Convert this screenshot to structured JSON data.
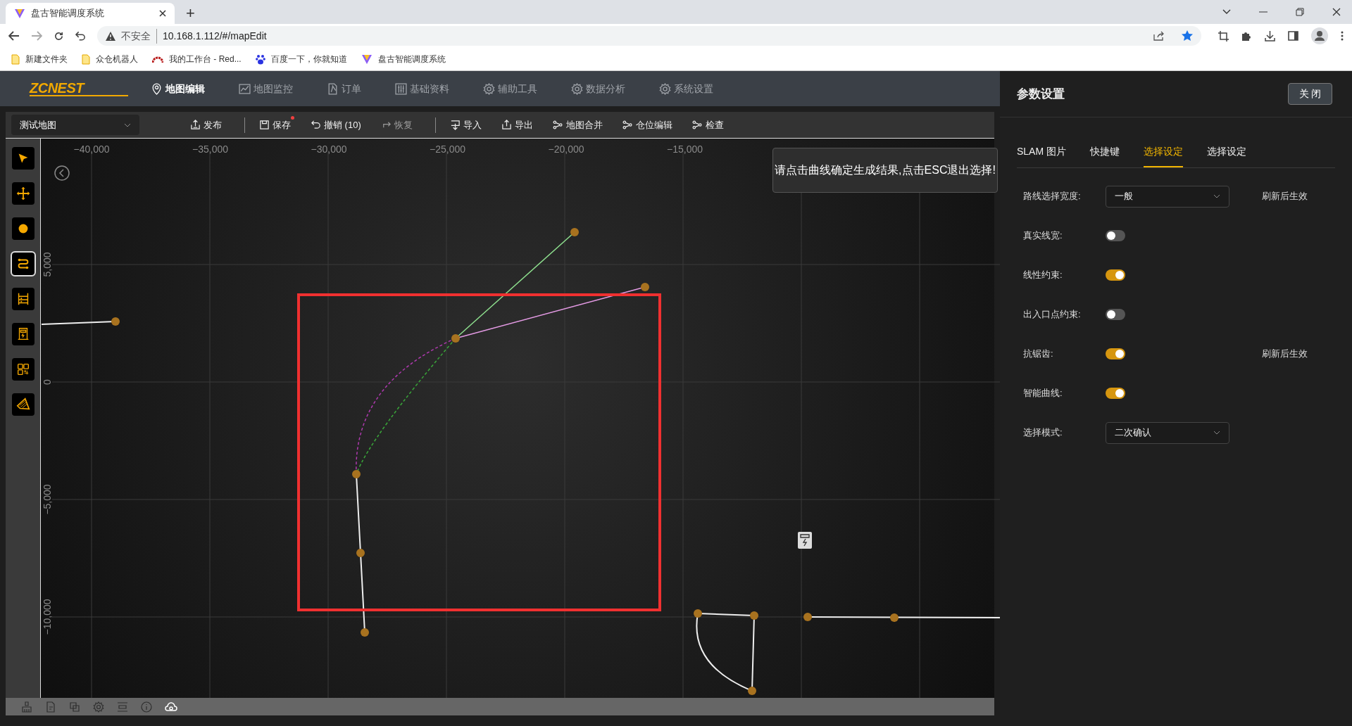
{
  "browser": {
    "tab_title": "盘古智能调度系统",
    "new_tab": "+",
    "security_label": "不安全",
    "url": "10.168.1.112/#/mapEdit",
    "bookmarks": [
      {
        "label": "新建文件夹",
        "kind": "folder"
      },
      {
        "label": "众仓机器人",
        "kind": "folder"
      },
      {
        "label": "我的工作台 - Red...",
        "kind": "redmine"
      },
      {
        "label": "百度一下，你就知道",
        "kind": "baidu"
      },
      {
        "label": "盘古智能调度系统",
        "kind": "app"
      }
    ]
  },
  "app": {
    "logo": "ZCNEST",
    "nav": [
      {
        "label": "地图编辑",
        "selected": true
      },
      {
        "label": "地图监控",
        "selected": false
      },
      {
        "label": "订单",
        "selected": false
      },
      {
        "label": "基础资料",
        "selected": false
      },
      {
        "label": "辅助工具",
        "selected": false
      },
      {
        "label": "数据分析",
        "selected": false
      },
      {
        "label": "系统设置",
        "selected": false
      }
    ]
  },
  "toolbar": {
    "map_select": "测试地图",
    "groups": [
      [
        {
          "label": "发布",
          "disabled": false,
          "unsaved": false
        }
      ],
      [
        {
          "label": "保存",
          "disabled": false,
          "unsaved": true
        },
        {
          "label": "撤销 (10)",
          "disabled": false,
          "unsaved": false
        },
        {
          "label": "恢复",
          "disabled": true,
          "unsaved": false
        }
      ],
      [
        {
          "label": "导入",
          "disabled": false,
          "unsaved": false
        },
        {
          "label": "导出",
          "disabled": false,
          "unsaved": false
        },
        {
          "label": "地图合并",
          "disabled": false,
          "unsaved": false
        },
        {
          "label": "仓位编辑",
          "disabled": false,
          "unsaved": false
        },
        {
          "label": "检查",
          "disabled": false,
          "unsaved": false
        }
      ]
    ]
  },
  "tools": [
    {
      "selected": false
    },
    {
      "selected": false
    },
    {
      "selected": false
    },
    {
      "selected": true
    },
    {
      "selected": false
    },
    {
      "selected": false
    },
    {
      "selected": false
    },
    {
      "selected": false
    }
  ],
  "map": {
    "x_labels": [
      "−40,000",
      "−35,000",
      "−30,000",
      "−25,000",
      "−20,000",
      "−15,000"
    ],
    "y_labels": [
      "5,000",
      "0",
      "−5,000",
      "−10,000"
    ],
    "hint": "请点击曲线确定生成结果,点击ESC退出选择!"
  },
  "panel": {
    "title": "参数设置",
    "close": "关 闭",
    "tabs": [
      {
        "label": "SLAM 图片",
        "selected": false
      },
      {
        "label": "快捷键",
        "selected": false
      },
      {
        "label": "选择设定",
        "selected": true
      },
      {
        "label": "选择设定",
        "selected": false
      }
    ],
    "settings": [
      {
        "kind": "select",
        "label": "路线选择宽度:",
        "value": "一般",
        "note": "刷新后生效"
      },
      {
        "kind": "toggle",
        "label": "真实线宽:",
        "on": false
      },
      {
        "kind": "toggle",
        "label": "线性约束:",
        "on": true
      },
      {
        "kind": "toggle",
        "label": "出入口点约束:",
        "on": false
      },
      {
        "kind": "toggle",
        "label": "抗锯齿:",
        "on": true,
        "note": "刷新后生效"
      },
      {
        "kind": "toggle",
        "label": "智能曲线:",
        "on": true
      },
      {
        "kind": "select",
        "label": "选择模式:",
        "value": "二次确认"
      }
    ]
  }
}
